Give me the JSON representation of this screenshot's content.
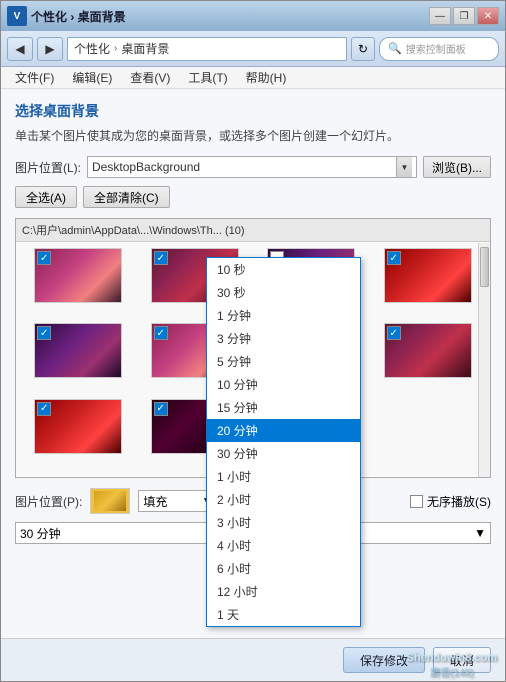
{
  "window": {
    "title": "个性化 › 桌面背景",
    "logo": "V",
    "controls": {
      "minimize": "—",
      "restore": "❐",
      "close": "✕"
    }
  },
  "toolbar": {
    "back_btn": "◀",
    "forward_btn": "▶",
    "breadcrumb": {
      "part1": "个性化",
      "sep": "›",
      "part2": "桌面背景"
    },
    "refresh_btn": "↻",
    "search_placeholder": "搜索控制面板"
  },
  "menu": {
    "items": [
      "文件(F)",
      "编辑(E)",
      "查看(V)",
      "工具(T)",
      "帮助(H)"
    ]
  },
  "content": {
    "page_title": "选择桌面背景",
    "page_desc": "单击某个图片使其成为您的桌面背景，或选择多个图片创建一个幻灯片。",
    "image_location_label": "图片位置(L):",
    "image_location_value": "DesktopBackground",
    "browse_btn": "浏览(B)...",
    "select_all_btn": "全选(A)",
    "clear_all_btn": "全部清除(C)",
    "path_bar": "C:\\用户\\admin\\AppData\\...\\Windows\\Th... (10)",
    "position_label": "图片位置(P):",
    "position_value": "填充",
    "shuffle_label": "无序播放(S)",
    "interval_value": "30 分钟"
  },
  "dropdown": {
    "items": [
      {
        "label": "10 秒",
        "selected": false
      },
      {
        "label": "30 秒",
        "selected": false
      },
      {
        "label": "1 分钟",
        "selected": false
      },
      {
        "label": "3 分钟",
        "selected": false
      },
      {
        "label": "5 分钟",
        "selected": false
      },
      {
        "label": "10 分钟",
        "selected": false
      },
      {
        "label": "15 分钟",
        "selected": false
      },
      {
        "label": "20 分钟",
        "selected": true
      },
      {
        "label": "30 分钟",
        "selected": false
      },
      {
        "label": "1 小时",
        "selected": false
      },
      {
        "label": "2 小时",
        "selected": false
      },
      {
        "label": "3 小时",
        "selected": false
      },
      {
        "label": "4 小时",
        "selected": false
      },
      {
        "label": "6 小时",
        "selected": false
      },
      {
        "label": "12 小时",
        "selected": false
      },
      {
        "label": "1 天",
        "selected": false
      }
    ]
  },
  "footer": {
    "save_btn": "保存修改",
    "cancel_btn": "取消"
  },
  "watermark": {
    "line1": "Shenduwin8.com",
    "line2": "麝香(148)"
  }
}
